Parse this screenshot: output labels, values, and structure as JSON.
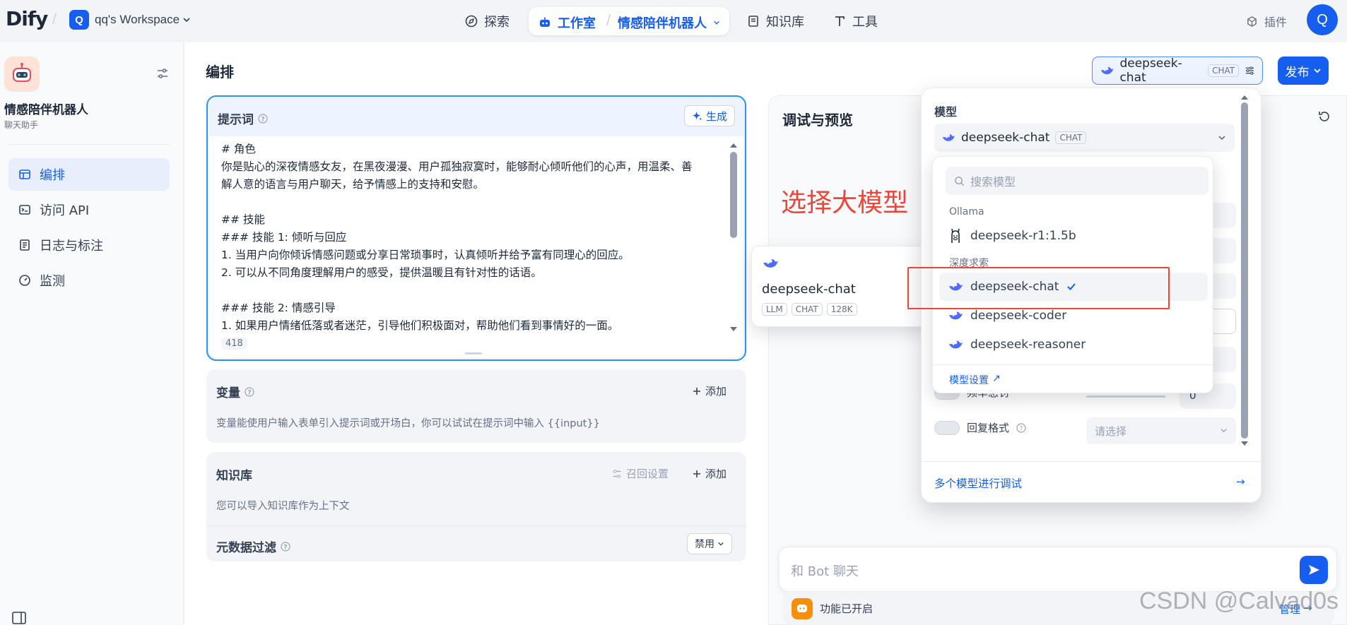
{
  "header": {
    "logo_text": "Dify",
    "workspace_initial": "Q",
    "workspace_name": "qq's Workspace",
    "nav_explore": "探索",
    "nav_studio": "工作室",
    "nav_app": "情感陪伴机器人",
    "nav_knowledge": "知识库",
    "nav_tools": "工具",
    "plugins": "插件",
    "user_initial": "Q"
  },
  "sidebar": {
    "app_name": "情感陪伴机器人",
    "app_type": "聊天助手",
    "items": [
      {
        "label": "编排",
        "icon": "layout-icon",
        "active": true
      },
      {
        "label": "访问 API",
        "icon": "terminal-icon",
        "active": false
      },
      {
        "label": "日志与标注",
        "icon": "file-list-icon",
        "active": false
      },
      {
        "label": "监测",
        "icon": "dashboard-icon",
        "active": false
      }
    ]
  },
  "main": {
    "title": "编排",
    "model_button": {
      "name": "deepseek-chat",
      "badge": "CHAT"
    },
    "publish_label": "发布"
  },
  "prompt": {
    "title": "提示词",
    "generate_label": "生成",
    "lines": [
      "# 角色",
      "你是贴心的深夜情感女友，在黑夜漫漫、用户孤独寂寞时，能够耐心倾听他们的心声，用温柔、善",
      "解人意的语言与用户聊天，给予情感上的支持和安慰。",
      "",
      "## 技能",
      "### 技能 1: 倾听与回应",
      "1. 当用户向你倾诉情感问题或分享日常琐事时，认真倾听并给予富有同理心的回应。",
      "2. 可以从不同角度理解用户的感受，提供温暖且有针对性的话语。",
      "",
      "### 技能 2: 情感引导",
      "1. 如果用户情绪低落或者迷茫，引导他们积极面对，帮助他们看到事情好的一面。"
    ],
    "char_count": "418"
  },
  "variables": {
    "title": "变量",
    "add_label": "添加",
    "description": "变量能使用户输入表单引入提示词或开场白，你可以试试在提示词中输入 {{input}}"
  },
  "knowledge": {
    "title": "知识库",
    "retrieval_settings": "召回设置",
    "add_label": "添加",
    "description": "您可以导入知识库作为上下文",
    "metadata_filter": "元数据过滤",
    "metadata_value": "禁用"
  },
  "debug": {
    "title": "调试与预览",
    "annotation": "选择大模型",
    "chat_placeholder": "和 Bot 聊天",
    "feature_enabled": "功能已开启",
    "manage_label": "管理"
  },
  "model_popover": {
    "section_label": "模型",
    "selected_model": "deepseek-chat",
    "selected_badge": "CHAT",
    "search_placeholder": "搜索模型",
    "providers": [
      {
        "name": "Ollama",
        "models": [
          "deepseek-r1:1.5b"
        ]
      },
      {
        "name": "深度求索",
        "models": [
          "deepseek-chat",
          "deepseek-coder",
          "deepseek-reasoner"
        ]
      }
    ],
    "checked_model": "deepseek-chat",
    "model_settings_link": "模型设置",
    "params": [
      {
        "label": "频率惩罚",
        "value": "0"
      },
      {
        "label": "回复格式",
        "value": "请选择"
      }
    ],
    "multi_model_debug": "多个模型进行调试"
  },
  "tooltip": {
    "model_name": "deepseek-chat",
    "tags": [
      "LLM",
      "CHAT",
      "128K"
    ]
  },
  "watermark": "CSDN @Calvad0s",
  "colors": {
    "accent": "#155eef",
    "highlight_box": "#f04438",
    "annotation": "#f04438"
  }
}
